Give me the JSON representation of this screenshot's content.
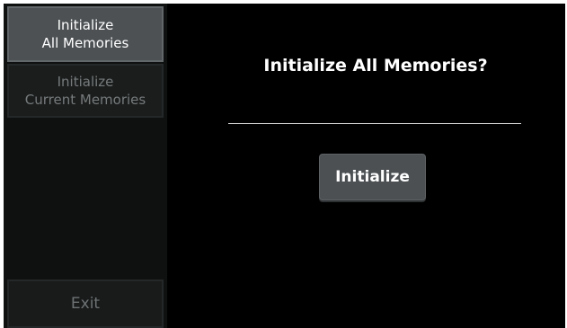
{
  "sidebar": {
    "items": [
      {
        "line1": "Initialize",
        "line2": "All Memories"
      },
      {
        "line1": "Initialize",
        "line2": "Current Memories"
      }
    ],
    "exit_label": "Exit"
  },
  "main": {
    "title": "Initialize All Memories?",
    "action_label": "Initialize"
  },
  "colors": {
    "background": "#000000",
    "active_button": "#4d5154",
    "inactive_text": "#767a7b",
    "divider": "#d8d8d8"
  }
}
